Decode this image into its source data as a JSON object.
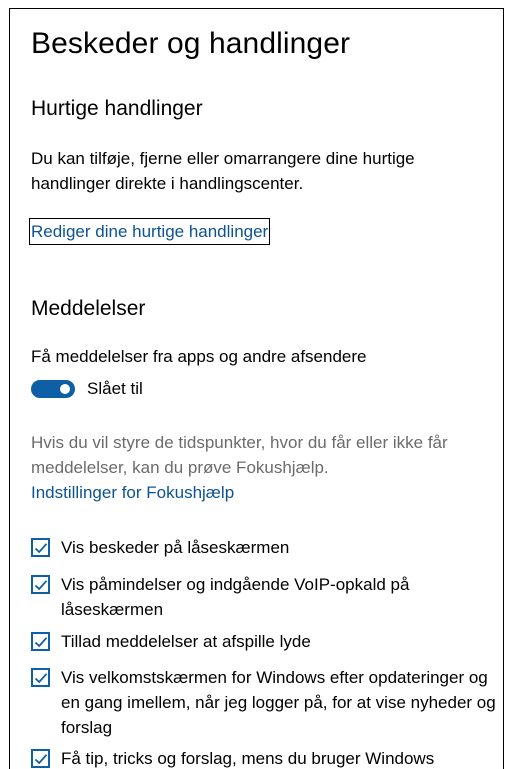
{
  "title": "Beskeder og handlinger",
  "quick_actions": {
    "heading": "Hurtige handlinger",
    "description": "Du kan tilføje, fjerne eller omarrangere dine hurtige handlinger direkte i handlingscenter.",
    "edit_link": "Rediger dine hurtige handlinger"
  },
  "notifications": {
    "heading": "Meddelelser",
    "get_notifications_label": "Få meddelelser fra apps og andre afsendere",
    "toggle_state": "Slået til",
    "focus_hint": "Hvis du vil styre de tidspunkter, hvor du får eller ikke får meddelelser, kan du prøve Fokushjælp.",
    "focus_link": "Indstillinger for Fokushjælp",
    "checkboxes": [
      {
        "label": "Vis beskeder på låseskærmen",
        "checked": true
      },
      {
        "label": "Vis påmindelser og indgående VoIP-opkald på låseskærmen",
        "checked": true
      },
      {
        "label": "Tillad meddelelser at afspille lyde",
        "checked": true
      },
      {
        "label": "Vis velkomstskærmen for Windows efter opdateringer og en gang imellem, når jeg logger på, for at vise nyheder og forslag",
        "checked": true
      },
      {
        "label": "Få tip, tricks og forslag, mens du bruger Windows",
        "checked": true
      }
    ]
  },
  "colors": {
    "accent": "#0e5fa6",
    "link": "#0b5394",
    "muted": "#6b6b6b"
  }
}
